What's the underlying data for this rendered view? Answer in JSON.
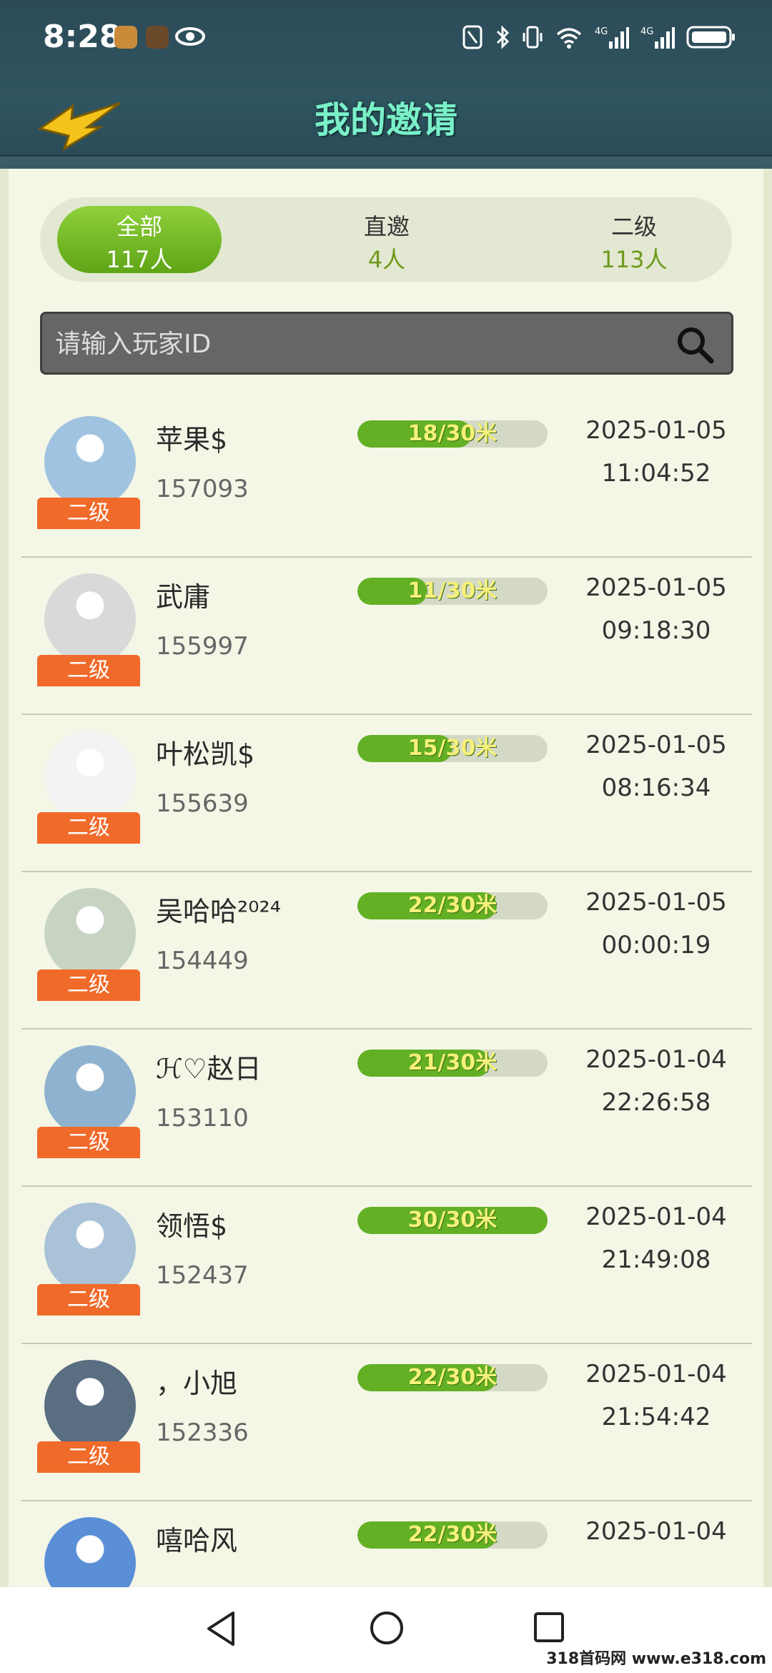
{
  "status_bar": {
    "time": "8:28"
  },
  "header": {
    "title": "我的邀请"
  },
  "tabs": [
    {
      "label": "全部",
      "count": "117人"
    },
    {
      "label": "直邀",
      "count": "4人"
    },
    {
      "label": "二级",
      "count": "113人"
    }
  ],
  "search": {
    "placeholder": "请输入玩家ID"
  },
  "players": [
    {
      "name": "苹果$",
      "id": "157093",
      "level": "二级",
      "progress": "18/30米",
      "progress_value": 18,
      "date": "2025-01-05",
      "time": "11:04:52"
    },
    {
      "name": "武庸",
      "id": "155997",
      "level": "二级",
      "progress": "11/30米",
      "progress_value": 11,
      "date": "2025-01-05",
      "time": "09:18:30"
    },
    {
      "name": "叶松凯$",
      "id": "155639",
      "level": "二级",
      "progress": "15/30米",
      "progress_value": 15,
      "date": "2025-01-05",
      "time": "08:16:34"
    },
    {
      "name": "吴哈哈²⁰²⁴",
      "id": "154449",
      "level": "二级",
      "progress": "22/30米",
      "progress_value": 22,
      "date": "2025-01-05",
      "time": "00:00:19"
    },
    {
      "name": "ℋ♡赵日",
      "id": "153110",
      "level": "二级",
      "progress": "21/30米",
      "progress_value": 21,
      "date": "2025-01-04",
      "time": "22:26:58"
    },
    {
      "name": "领悟$",
      "id": "152437",
      "level": "二级",
      "progress": "30/30米",
      "progress_value": 30,
      "date": "2025-01-04",
      "time": "21:49:08"
    },
    {
      "name": "，小旭",
      "id": "152336",
      "level": "二级",
      "progress": "22/30米",
      "progress_value": 22,
      "date": "2025-01-04",
      "time": "21:54:42"
    },
    {
      "name": "嘻哈风",
      "id": "",
      "level": "",
      "progress": "22/30米",
      "progress_value": 22,
      "date": "2025-01-04",
      "time": ""
    }
  ],
  "progress_max": 30,
  "watermark": "318首码网 www.e318.com",
  "colors": {
    "accent": "#63b024",
    "badge": "#f06a2a",
    "header": "#2c4a57"
  }
}
